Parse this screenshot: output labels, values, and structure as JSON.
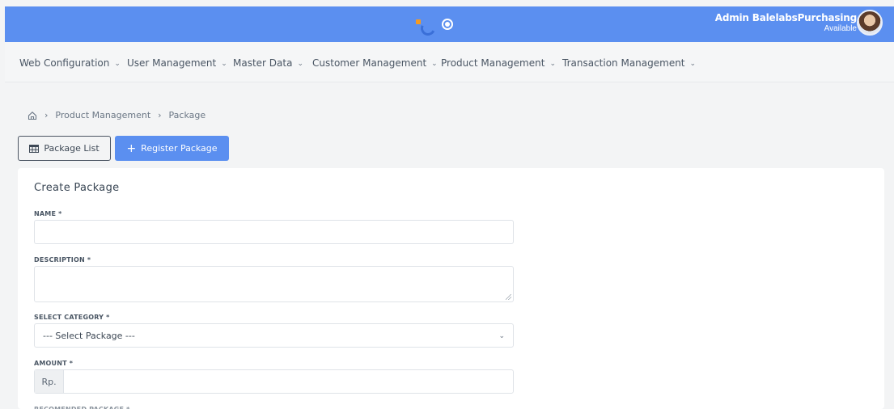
{
  "header": {
    "user_name": "Admin BalelabsPurchasing",
    "user_status": "Available",
    "colors": {
      "bar": "#5b8ff0",
      "logo_orange": "#f59b23"
    }
  },
  "nav": {
    "items": [
      {
        "label": "Web Configuration"
      },
      {
        "label": "User Management"
      },
      {
        "label": "Master Data"
      },
      {
        "label": "Customer Management"
      },
      {
        "label": "Product Management"
      },
      {
        "label": "Transaction Management"
      }
    ],
    "chevron": "chevron-down-icon"
  },
  "breadcrumb": {
    "home_icon": "home-icon",
    "items": [
      "Product Management",
      "Package"
    ],
    "separator": "›"
  },
  "actions": {
    "list_label": "Package List",
    "register_label": "Register Package"
  },
  "form": {
    "title": "Create Package",
    "name_label": "NAME *",
    "name_value": "",
    "description_label": "DESCRIPTION *",
    "description_value": "",
    "category_label": "SELECT CATEGORY *",
    "category_selected": "--- Select Package ---",
    "amount_label": "AMOUNT *",
    "amount_prefix": "Rp.",
    "amount_value": "",
    "recommended_label": "RECOMENDED PACKAGE *"
  }
}
